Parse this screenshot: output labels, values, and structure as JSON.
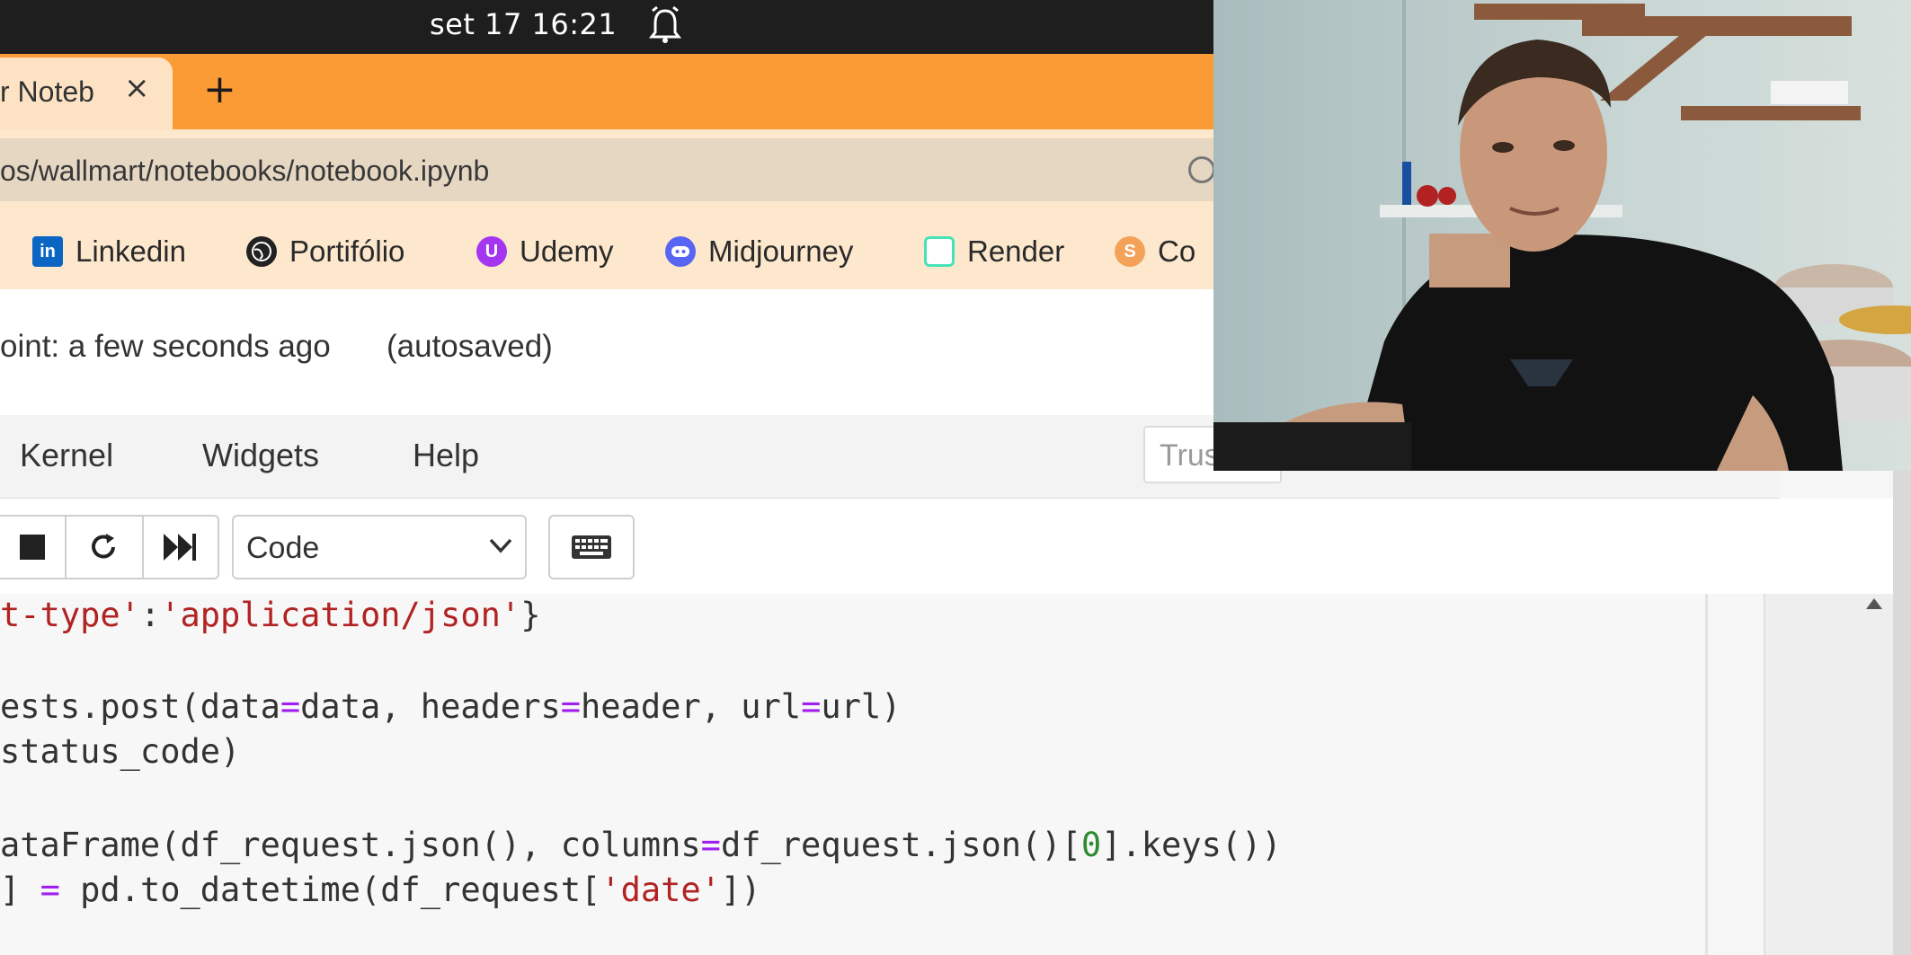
{
  "system_bar": {
    "clock": "set 17  16:21"
  },
  "tab": {
    "title": "r Noteb",
    "close": "×",
    "new_tab": "+"
  },
  "address_bar": {
    "url": "os/wallmart/notebooks/notebook.ipynb"
  },
  "bookmarks": [
    {
      "label": "Linkedin",
      "icon": "linkedin-icon",
      "color": "#0a66c2"
    },
    {
      "label": "Portifólio",
      "icon": "globe-icon",
      "color": "#222222"
    },
    {
      "label": "Udemy",
      "icon": "udemy-icon",
      "color": "#a435f0"
    },
    {
      "label": "Midjourney",
      "icon": "discord-icon",
      "color": "#5865f2"
    },
    {
      "label": "Render",
      "icon": "render-icon",
      "color": "#46e3b7"
    },
    {
      "label": "Co",
      "icon": "bookmark-icon",
      "color": "#f4a259"
    }
  ],
  "notebook": {
    "checkpoint": "oint: a few seconds ago",
    "autosaved": "(autosaved)"
  },
  "menu": {
    "kernel": "Kernel",
    "widgets": "Widgets",
    "help": "Help",
    "trusted": "Trusted"
  },
  "toolbar": {
    "cell_type": "Code"
  },
  "code_lines": [
    {
      "segments": [
        [
          "t-type'",
          "str"
        ],
        [
          ":",
          "plain"
        ],
        [
          "'application/json'",
          "str"
        ],
        [
          "}",
          "plain"
        ]
      ]
    },
    {
      "segments": [
        [
          "ests.post(data",
          "plain"
        ],
        [
          "=",
          "op"
        ],
        [
          "data, headers",
          "plain"
        ],
        [
          "=",
          "op"
        ],
        [
          "header, url",
          "plain"
        ],
        [
          "=",
          "op"
        ],
        [
          "url)",
          "plain"
        ]
      ]
    },
    {
      "segments": [
        [
          "status_code)",
          "plain"
        ]
      ]
    },
    {
      "segments": [
        [
          "ataFrame(df_request.json(), columns",
          "plain"
        ],
        [
          "=",
          "op"
        ],
        [
          "df_request.json()[",
          "plain"
        ],
        [
          "0",
          "num"
        ],
        [
          "].keys())",
          "plain"
        ]
      ]
    },
    {
      "segments": [
        [
          "] ",
          "plain"
        ],
        [
          "=",
          "op"
        ],
        [
          " pd.to_datetime(df_request[",
          "plain"
        ],
        [
          "'date'",
          "str"
        ],
        [
          "])",
          "plain"
        ]
      ]
    }
  ],
  "colors": {
    "tab_strip": "#fb9b36",
    "address_bar": "#fde8cd",
    "string": "#b22222",
    "operator": "#a020f0",
    "number": "#2e8b2e"
  }
}
